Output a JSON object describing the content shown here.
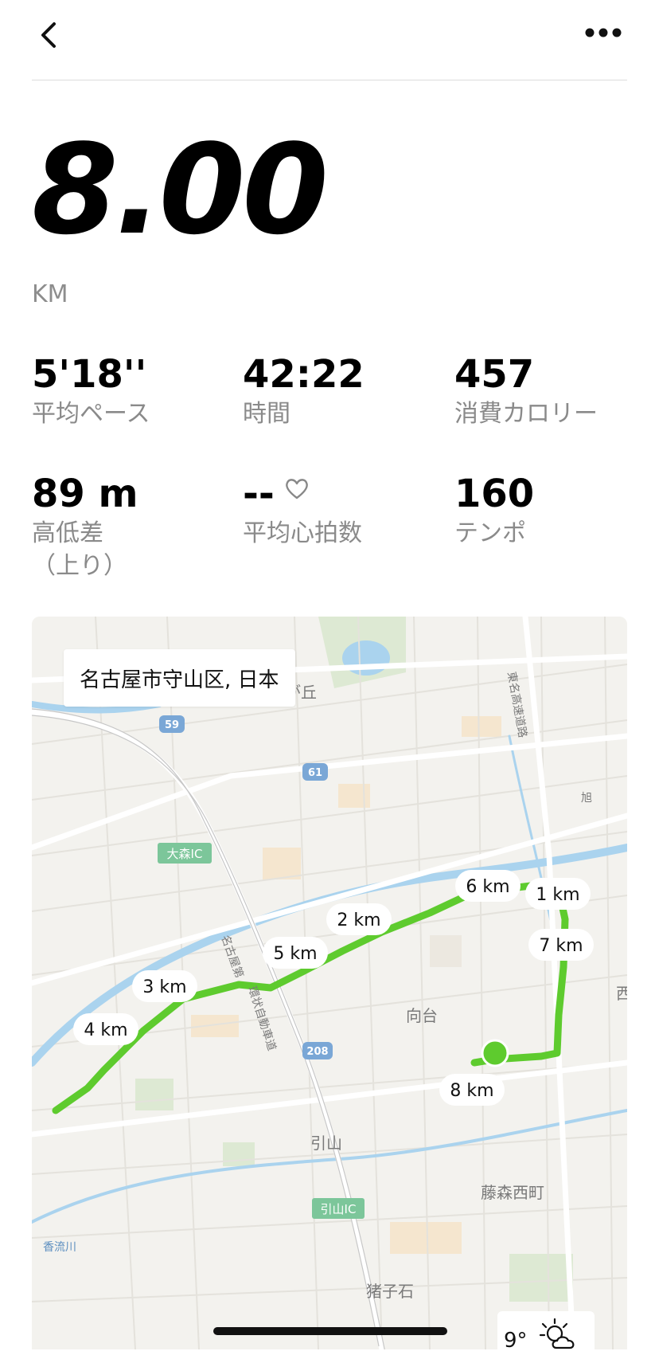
{
  "header": {
    "back_icon": "chevron-left-icon",
    "more_icon": "more-horizontal-icon"
  },
  "summary": {
    "distance": "8.00",
    "unit": "KM"
  },
  "stats": [
    {
      "value": "5'18''",
      "label": "平均ペース"
    },
    {
      "value": "42:22",
      "label": "時間"
    },
    {
      "value": "457",
      "label": "消費カロリー"
    },
    {
      "value": "89 m",
      "label": "高低差",
      "label2": "（上り）"
    },
    {
      "value": "--",
      "label": "平均心拍数",
      "icon": "heart-outline-icon"
    },
    {
      "value": "160",
      "label": "テンポ"
    }
  ],
  "map": {
    "location": "名古屋市守山区, 日本",
    "route_color": "#5ecb2e",
    "km_markers": [
      "1 km",
      "2 km",
      "3 km",
      "4 km",
      "5 km",
      "6 km",
      "7 km",
      "8 km"
    ],
    "place_labels": [
      "が丘",
      "東名高速道路",
      "旭",
      "大森IC",
      "名古屋第",
      "環状自動車道",
      "向台",
      "西",
      "引山",
      "藤森西町",
      "引山IC",
      "香流川",
      "猪子石"
    ],
    "road_numbers": [
      "59",
      "61",
      "208"
    ],
    "weather": {
      "temp": "9°",
      "icon": "partly-sunny-icon"
    }
  }
}
